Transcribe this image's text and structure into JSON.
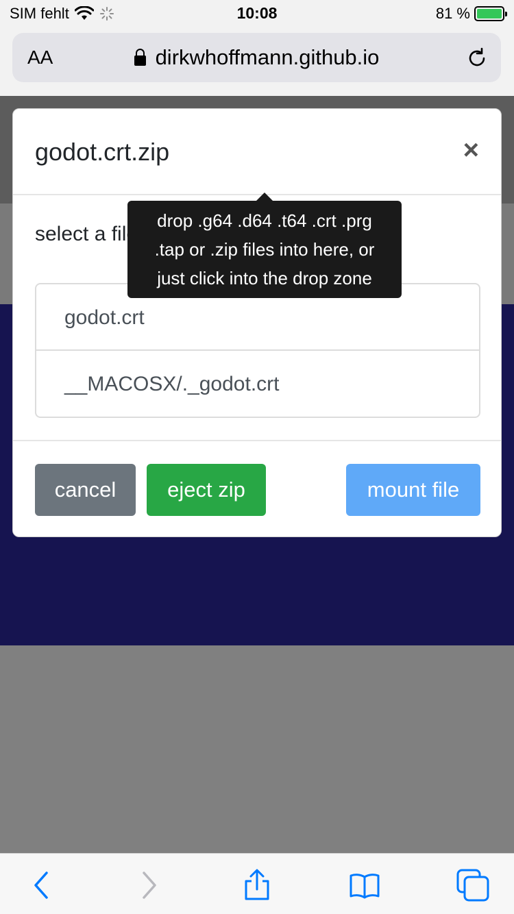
{
  "status_bar": {
    "carrier": "SIM fehlt",
    "time": "10:08",
    "battery": "81 %"
  },
  "url_bar": {
    "text_size_label": "AA",
    "url": "dirkwhoffmann.github.io"
  },
  "modal": {
    "title": "godot.crt.zip",
    "close_label": "×",
    "select_label": "select a file",
    "files": [
      "godot.crt",
      "__MACOSX/._godot.crt"
    ],
    "buttons": {
      "cancel": "cancel",
      "eject": "eject zip",
      "mount": "mount file"
    }
  },
  "tooltip": {
    "lines": [
      "drop .g64 .d64 .t64 .crt .prg",
      ".tap or .zip files into here, or",
      "just click into the drop zone"
    ]
  },
  "toolbar": {
    "icons": [
      "back-icon",
      "forward-icon",
      "share-icon",
      "bookmarks-icon",
      "tabs-icon"
    ]
  },
  "colors": {
    "accent_blue": "#007aff",
    "cancel_gray": "#6c757d",
    "eject_green": "#28a745",
    "mount_blue": "#5fa9f8",
    "navy": "#161450"
  }
}
